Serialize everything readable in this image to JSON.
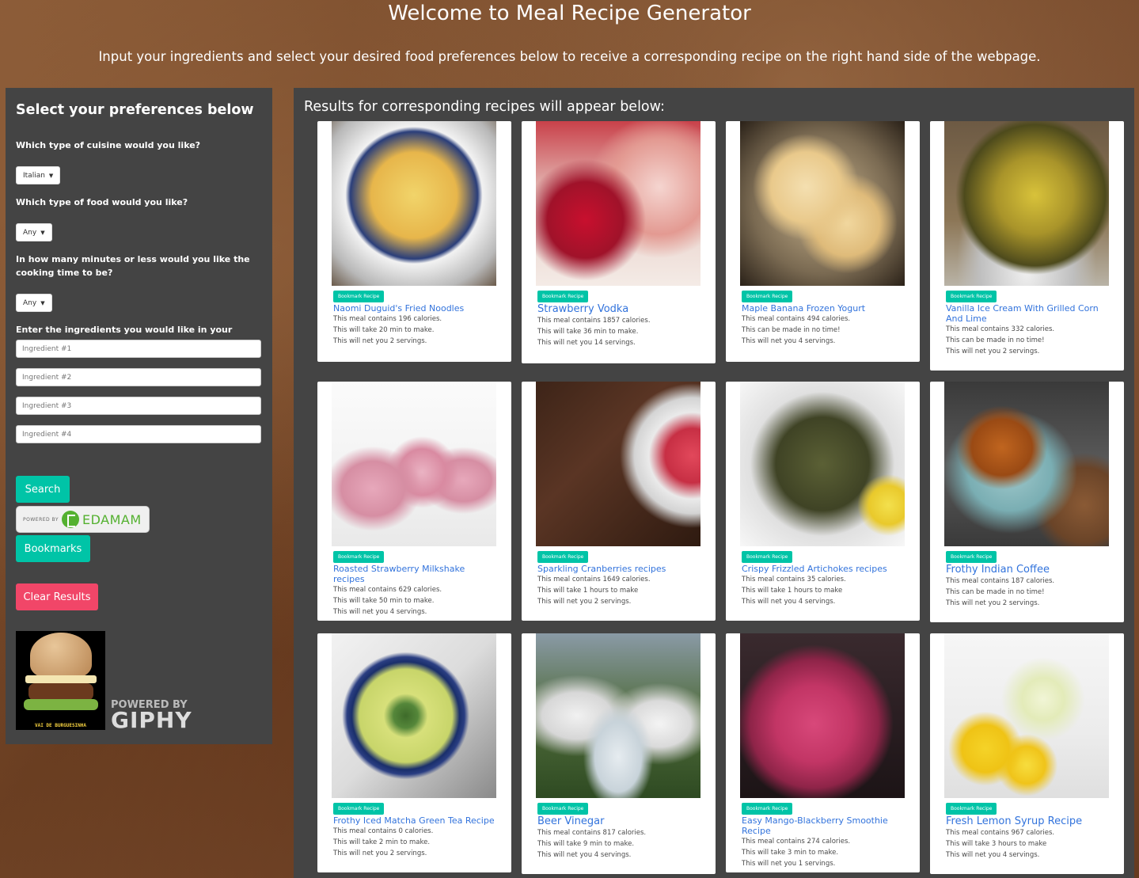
{
  "header": {
    "title": "Welcome to Meal Recipe Generator",
    "subtitle": "Input your ingredients and select your desired food preferences below to receive a corresponding recipe on the right hand side of the webpage."
  },
  "sidebar": {
    "heading": "Select your preferences below",
    "cuisine_label": "Which type of cuisine would you like?",
    "cuisine_value": "Italian",
    "food_label": "Which type of food would you like?",
    "food_value": "Any",
    "time_label": "In how many minutes or less would you like the cooking time to be?",
    "time_value": "Any",
    "ingredients_label": "Enter the ingredients you would like in your dish.",
    "ingredient_placeholders": [
      "Ingredient #1",
      "Ingredient #2",
      "Ingredient #3",
      "Ingredient #4"
    ],
    "search_label": "Search",
    "edamam_powered": "POWERED BY",
    "edamam_name": "EDAMAM",
    "bookmarks_label": "Bookmarks",
    "clear_label": "Clear Results",
    "gif_caption": "VAI DE BURGUESINHA",
    "giphy_powered": "POWERED BY",
    "giphy_name": "GIPHY"
  },
  "results": {
    "heading": "Results for corresponding recipes will appear below:",
    "bookmark_label": "Bookmark Recipe",
    "cards": [
      {
        "title": "Naomi Duguid's Fried Noodles",
        "calories": "This meal contains 196 calories.",
        "time": "This will take 20 min to make.",
        "servings": "This will net you 2 servings."
      },
      {
        "title": "Strawberry Vodka",
        "calories": "This meal contains 1857 calories.",
        "time": "This will take 36 min to make.",
        "servings": "This will net you 14 servings."
      },
      {
        "title": "Maple Banana Frozen Yogurt",
        "calories": "This meal contains 494 calories.",
        "time": "This can be made in no time!",
        "servings": "This will net you 4 servings."
      },
      {
        "title": "Vanilla Ice Cream With Grilled Corn And Lime",
        "calories": "This meal contains 332 calories.",
        "time": "This can be made in no time!",
        "servings": "This will net you 2 servings."
      },
      {
        "title": "Roasted Strawberry Milkshake recipes",
        "calories": "This meal contains 629 calories.",
        "time": "This will take 50 min to make.",
        "servings": "This will net you 4 servings."
      },
      {
        "title": "Sparkling Cranberries recipes",
        "calories": "This meal contains 1649 calories.",
        "time": "This will take 1 hours to make",
        "servings": "This will net you 2 servings."
      },
      {
        "title": "Crispy Frizzled Artichokes recipes",
        "calories": "This meal contains 35 calories.",
        "time": "This will take 1 hours to make",
        "servings": "This will net you 4 servings."
      },
      {
        "title": "Frothy Indian Coffee",
        "calories": "This meal contains 187 calories.",
        "time": "This can be made in no time!",
        "servings": "This will net you 2 servings."
      },
      {
        "title": "Frothy Iced Matcha Green Tea Recipe",
        "calories": "This meal contains 0 calories.",
        "time": "This will take 2 min to make.",
        "servings": "This will net you 2 servings."
      },
      {
        "title": "Beer Vinegar",
        "calories": "This meal contains 817 calories.",
        "time": "This will take 9 min to make.",
        "servings": "This will net you 4 servings."
      },
      {
        "title": "Easy Mango-Blackberry Smoothie Recipe",
        "calories": "This meal contains 274 calories.",
        "time": "This will take 3 min to make.",
        "servings": "This will net you 1 servings."
      },
      {
        "title": "Fresh Lemon Syrup Recipe",
        "calories": "This meal contains 967 calories.",
        "time": "This will take 3 hours to make",
        "servings": "This will net you 4 servings."
      }
    ]
  }
}
